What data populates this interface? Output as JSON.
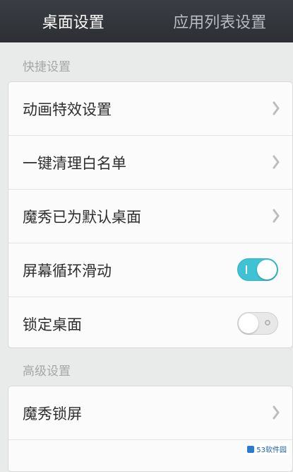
{
  "tabs": [
    {
      "label": "桌面设置",
      "active": true
    },
    {
      "label": "应用列表设置",
      "active": false
    }
  ],
  "sections": [
    {
      "title": "快捷设置",
      "items": [
        {
          "label": "动画特效设置",
          "control": "chevron-right-icon"
        },
        {
          "label": "一键清理白名单",
          "control": "chevron-right-icon"
        },
        {
          "label": "魔秀已为默认桌面",
          "control": "chevron-right-icon"
        },
        {
          "label": "屏幕循环滑动",
          "control": "toggle",
          "on": true
        },
        {
          "label": "锁定桌面",
          "control": "toggle",
          "on": false
        }
      ]
    },
    {
      "title": "高级设置",
      "items": [
        {
          "label": "魔秀锁屏",
          "control": "chevron-right-icon"
        },
        {
          "label": "",
          "control": "none"
        }
      ]
    }
  ],
  "watermark": "53软件园",
  "colors": {
    "tabbar": "#30343a",
    "toggle_on": "#3fc2d3",
    "background": "#e9eaea"
  }
}
